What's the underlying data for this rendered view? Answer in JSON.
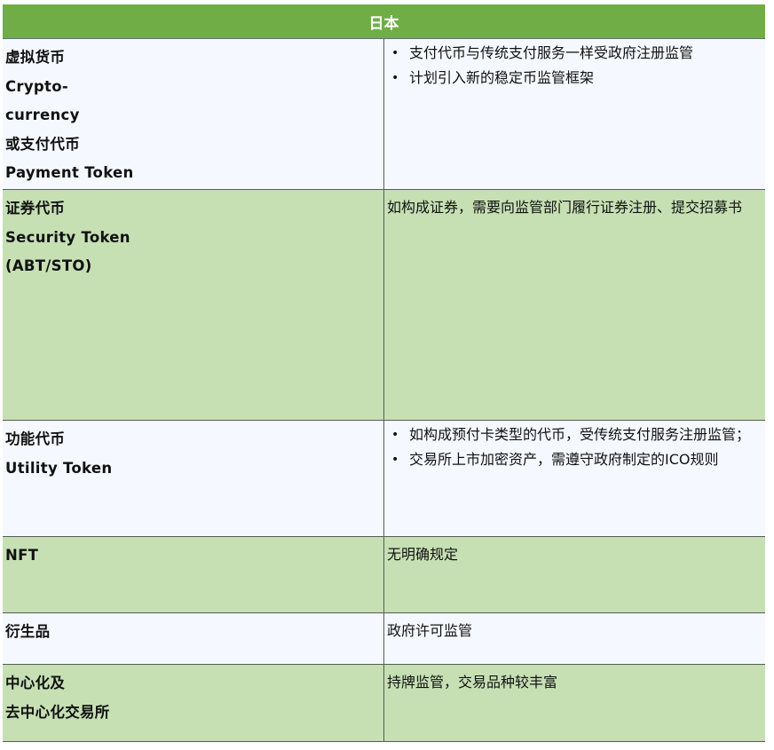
{
  "table": {
    "header": "日本",
    "colors": {
      "header_bg": "#70ad47",
      "row_light": "#f5f9ff",
      "row_green": "#c6e0b4"
    },
    "rows": [
      {
        "label_lines": [
          "虚拟货币",
          "Crypto-",
          "currency",
          "或支付代币",
          "Payment Token"
        ],
        "bullets": [
          "支付代币与传统支付服务一样受政府注册监管",
          "计划引入新的稳定币监管框架"
        ],
        "text": null
      },
      {
        "label_lines": [
          "证券代币",
          "Security Token",
          "(ABT/STO)"
        ],
        "bullets": null,
        "text": "如构成证券，需要向监管部门履行证券注册、提交招募书"
      },
      {
        "label_lines": [
          "功能代币",
          "Utility Token"
        ],
        "bullets": [
          "如构成预付卡类型的代币，受传统支付服务注册监管；",
          "交易所上市加密资产，需遵守政府制定的ICO规则"
        ],
        "text": null
      },
      {
        "label_lines": [
          "NFT"
        ],
        "bullets": null,
        "text": "无明确规定"
      },
      {
        "label_lines": [
          "衍生品"
        ],
        "bullets": null,
        "text": "政府许可监管"
      },
      {
        "label_lines": [
          "中心化及",
          "去中心化交易所"
        ],
        "bullets": null,
        "text": "持牌监管，交易品种较丰富"
      }
    ],
    "bullet_glyph": "•"
  }
}
